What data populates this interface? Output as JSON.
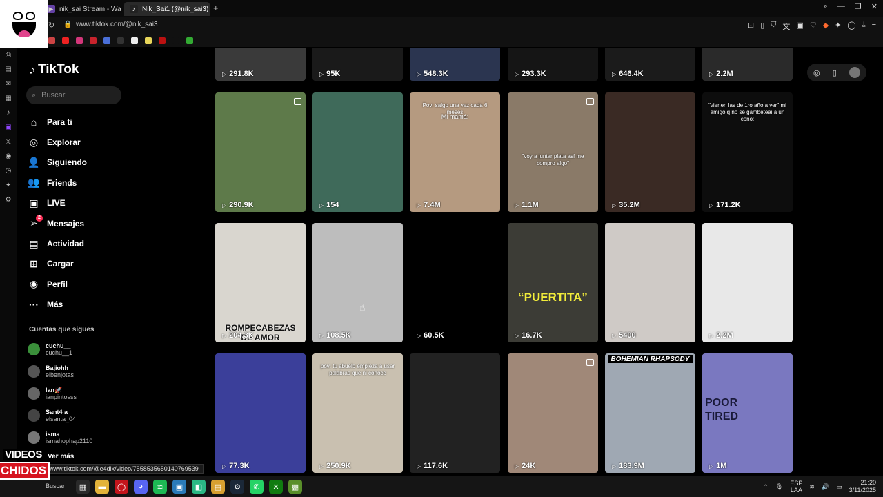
{
  "browser": {
    "tabs": [
      {
        "label": "nik_sai Stream - Watch Li",
        "active": false
      },
      {
        "label": "Nik_Sai1 (@nik_sai3) | Tik",
        "active": true
      }
    ],
    "new_tab": "+",
    "url": "www.tiktok.com/@nik_sai3",
    "status_url": "www.tiktok.com/@e4dix/video/7558535650140769539"
  },
  "tiktok": {
    "logo": "TikTok",
    "search_placeholder": "Buscar",
    "menu": [
      {
        "label": "Para ti",
        "icon": "home-icon",
        "glyph": "⌂"
      },
      {
        "label": "Explorar",
        "icon": "compass-icon",
        "glyph": "◎"
      },
      {
        "label": "Siguiendo",
        "icon": "following-icon",
        "glyph": "👤"
      },
      {
        "label": "Friends",
        "icon": "friends-icon",
        "glyph": "👥"
      },
      {
        "label": "LIVE",
        "icon": "live-icon",
        "glyph": "▣"
      },
      {
        "label": "Mensajes",
        "icon": "messages-icon",
        "glyph": "➢",
        "badge": "2"
      },
      {
        "label": "Actividad",
        "icon": "activity-icon",
        "glyph": "▤"
      },
      {
        "label": "Cargar",
        "icon": "upload-icon",
        "glyph": "⊞"
      },
      {
        "label": "Perfil",
        "icon": "profile-avatar-icon",
        "glyph": "◉"
      },
      {
        "label": "Más",
        "icon": "more-icon",
        "glyph": "···"
      }
    ],
    "following_title": "Cuentas que sigues",
    "following": [
      {
        "name": "cuchu__",
        "user": "cuchu__1",
        "color": "#3a8f3a"
      },
      {
        "name": "Bajiohh",
        "user": "elbenjotas",
        "color": "#555555"
      },
      {
        "name": "Ian🚀",
        "user": "ianpintosss",
        "color": "#666666"
      },
      {
        "name": "Sant4 a",
        "user": "elsanta_04",
        "color": "#444444"
      },
      {
        "name": "isma",
        "user": "ismahophap2110",
        "color": "#777777"
      }
    ],
    "see_more": "Ver más"
  },
  "videos": [
    {
      "views": "291.8K",
      "bg": "#3a3a3a"
    },
    {
      "views": "95K",
      "bg": "#1a1a1a"
    },
    {
      "views": "548.3K",
      "bg": "#2b3550"
    },
    {
      "views": "293.3K",
      "bg": "#151515"
    },
    {
      "views": "646.4K",
      "bg": "#1b1b1b"
    },
    {
      "views": "2.2M",
      "bg": "#2a2a2a"
    },
    {
      "views": "290.9K",
      "bg": "#5e7a4a",
      "multi": true
    },
    {
      "views": "154",
      "bg": "#3f6a5a"
    },
    {
      "views": "7.4M",
      "bg": "#b59a80",
      "cap_top": "Pov: salgo una vez cada 6 meses",
      "cap_mid": "Mi mamá:"
    },
    {
      "views": "1.1M",
      "bg": "#8a7a68",
      "multi": true,
      "cap_mid2": "\"voy a juntar plata así me compro algo\""
    },
    {
      "views": "35.2M",
      "bg": "#3a2a24"
    },
    {
      "views": "171.2K",
      "bg": "#0d0d0d",
      "cap_top": "\"vienen las de 1ro año a ver\" mi amigo q no se gambeteai a un cono:"
    },
    {
      "views": "204.3K",
      "bg": "#d9d6cf",
      "cap_bottom": "ROMPECABEZAS DE AMOR"
    },
    {
      "views": "108.5K",
      "bg": "#bdbdbd"
    },
    {
      "views": "60.5K",
      "bg": "#000000"
    },
    {
      "views": "16.7K",
      "bg": "#3c3c36",
      "big": "“PUERTITA”"
    },
    {
      "views": "5400",
      "bg": "#cfcac6"
    },
    {
      "views": "2.2M",
      "bg": "#e8e8e8"
    },
    {
      "views": "77.3K",
      "bg": "#3b3f9a"
    },
    {
      "views": "250.9K",
      "bg": "#c9c0b0",
      "cap_top": "pov: tu abuelo empieza a usar palabras que ni conoce"
    },
    {
      "views": "117.6K",
      "bg": "#222222"
    },
    {
      "views": "24K",
      "bg": "#a08878",
      "multi": true
    },
    {
      "views": "183.9M",
      "bg": "#9fa8b3",
      "big_top": "BOHEMIAN RHAPSODY"
    },
    {
      "views": "1M",
      "bg": "#7a78c0",
      "big_left": "POOR TIRED"
    }
  ],
  "taskbar": {
    "search": "Buscar",
    "lang": "ESP",
    "lang2": "LAA",
    "time": "21:20",
    "date": "3/11/2025"
  },
  "watermark": {
    "line1": "VIDEOS",
    "line2": "CHIDOS"
  }
}
